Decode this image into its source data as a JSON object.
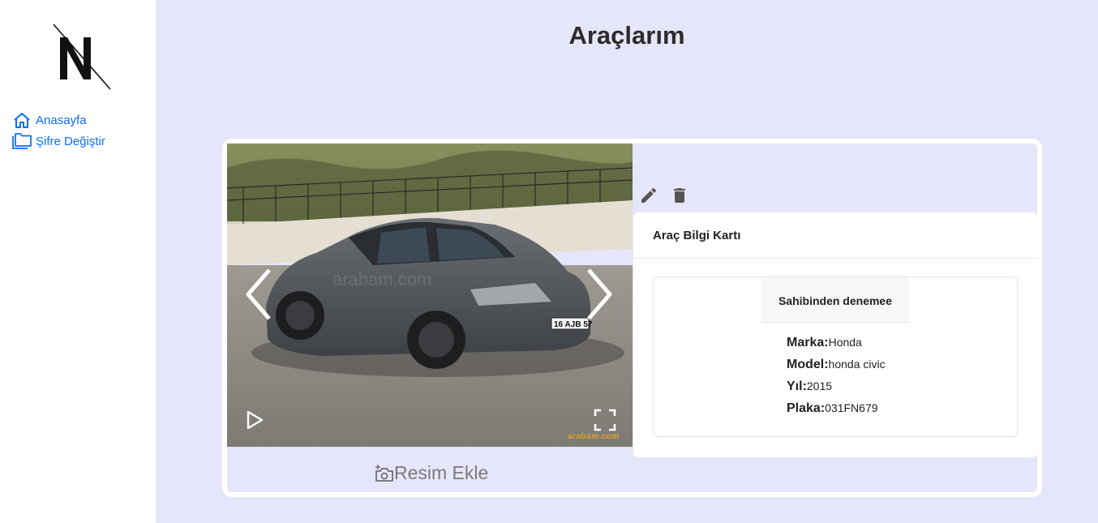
{
  "sidebar": {
    "logo_alt": "N",
    "items": [
      {
        "label": "Anasayfa",
        "icon": "home-icon"
      },
      {
        "label": "Şifre Değiştir",
        "icon": "folder-icon"
      }
    ]
  },
  "page": {
    "title": "Araçlarım"
  },
  "vehicle": {
    "photo_plate": "16 AJB 57",
    "watermark": "arabam.com",
    "photo_badge": "arabam.com",
    "add_photo_label": "Resim Ekle",
    "card_title": "Araç Bilgi Kartı",
    "owner": "Sahibinden denemee",
    "details": [
      {
        "label": "Marka:",
        "value": "Honda"
      },
      {
        "label": "Model:",
        "value": "honda civic"
      },
      {
        "label": "Yıl:",
        "value": "2015"
      },
      {
        "label": "Plaka:",
        "value": "031FN679"
      }
    ]
  },
  "colors": {
    "accent": "#0d6efd",
    "background": "#e6e6fa",
    "icon_gray": "#555555"
  }
}
